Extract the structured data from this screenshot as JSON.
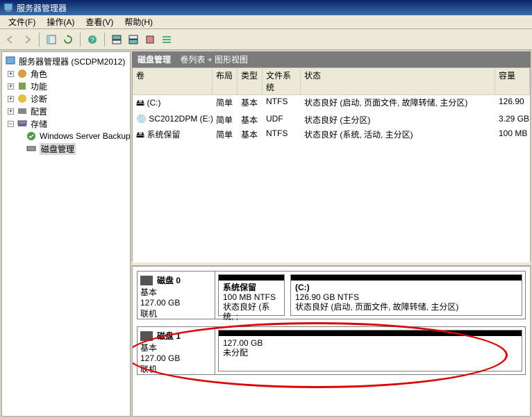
{
  "title": "服务器管理器",
  "menu": {
    "file": "文件(F)",
    "action": "操作(A)",
    "view": "查看(V)",
    "help": "帮助(H)"
  },
  "tree": {
    "root": "服务器管理器 (SCDPM2012)",
    "roles": "角色",
    "features": "功能",
    "diag": "诊断",
    "config": "配置",
    "storage": "存储",
    "wsb": "Windows Server Backup",
    "diskmgmt": "磁盘管理"
  },
  "header": {
    "title": "磁盘管理",
    "subtitle": "卷列表 + 图形视图"
  },
  "cols": {
    "vol": "卷",
    "layout": "布局",
    "type": "类型",
    "fs": "文件系统",
    "status": "状态",
    "cap": "容量"
  },
  "vols": [
    {
      "name": "(C:)",
      "layout": "简单",
      "type": "基本",
      "fs": "NTFS",
      "status": "状态良好 (启动, 页面文件, 故障转储, 主分区)",
      "cap": "126.90"
    },
    {
      "name": "SC2012DPM (E:)",
      "layout": "简单",
      "type": "基本",
      "fs": "UDF",
      "status": "状态良好 (主分区)",
      "cap": "3.29 GB"
    },
    {
      "name": "系统保留",
      "layout": "简单",
      "type": "基本",
      "fs": "NTFS",
      "status": "状态良好 (系统, 活动, 主分区)",
      "cap": "100 MB"
    }
  ],
  "disks": [
    {
      "title": "磁盘 0",
      "type": "基本",
      "size": "127.00 GB",
      "state": "联机",
      "parts": [
        {
          "name": "系统保留",
          "size": "100 MB NTFS",
          "status": "状态良好 (系统, ;"
        },
        {
          "name": "(C:)",
          "size": "126.90 GB NTFS",
          "status": "状态良好 (启动, 页面文件, 故障转储, 主分区)"
        }
      ]
    },
    {
      "title": "磁盘 1",
      "type": "基本",
      "size": "127.00 GB",
      "state": "联机",
      "parts": [
        {
          "name": "",
          "size": "127.00 GB",
          "status": "未分配"
        }
      ]
    }
  ]
}
